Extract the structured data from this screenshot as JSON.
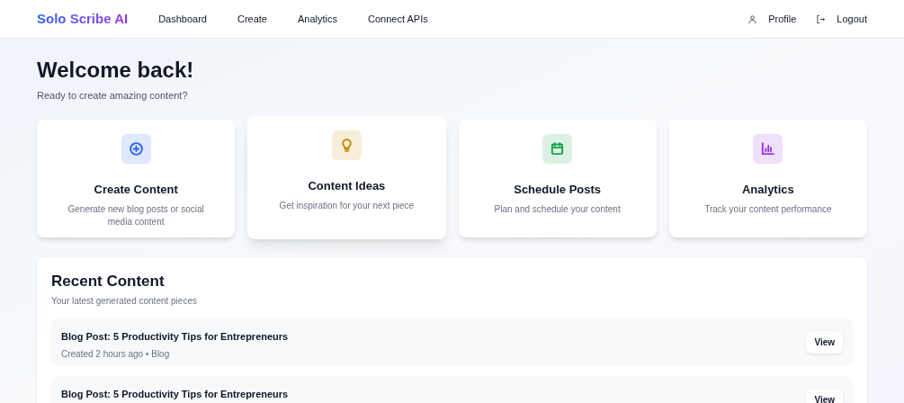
{
  "brand": "Solo Scribe AI",
  "nav": [
    "Dashboard",
    "Create",
    "Analytics",
    "Connect APIs"
  ],
  "user_menu": [
    {
      "kind": "profile",
      "label": "Profile"
    },
    {
      "kind": "logout",
      "label": "Logout"
    }
  ],
  "welcome": {
    "title": "Welcome back!",
    "subtitle": "Ready to create amazing content?"
  },
  "cards": [
    {
      "kind": "plus",
      "color": "#2563eb",
      "title": "Create Content",
      "description": "Generate new blog posts or social media content",
      "hovered": false
    },
    {
      "kind": "bulb",
      "color": "#ca8a04",
      "title": "Content Ideas",
      "description": "Get inspiration for your next piece",
      "hovered": true
    },
    {
      "kind": "calendar",
      "color": "#16a34a",
      "title": "Schedule Posts",
      "description": "Plan and schedule your content",
      "hovered": false
    },
    {
      "kind": "chart",
      "color": "#9333ea",
      "title": "Analytics",
      "description": "Track your content performance",
      "hovered": false
    }
  ],
  "recent": {
    "title": "Recent Content",
    "subtitle": "Your latest generated content pieces",
    "items": [
      {
        "title": "Blog Post: 5 Productivity Tips for Entrepreneurs",
        "meta": "Created 2 hours ago • Blog",
        "button": "View"
      },
      {
        "title": "Blog Post: 5 Productivity Tips for Entrepreneurs",
        "button": "View"
      }
    ]
  }
}
